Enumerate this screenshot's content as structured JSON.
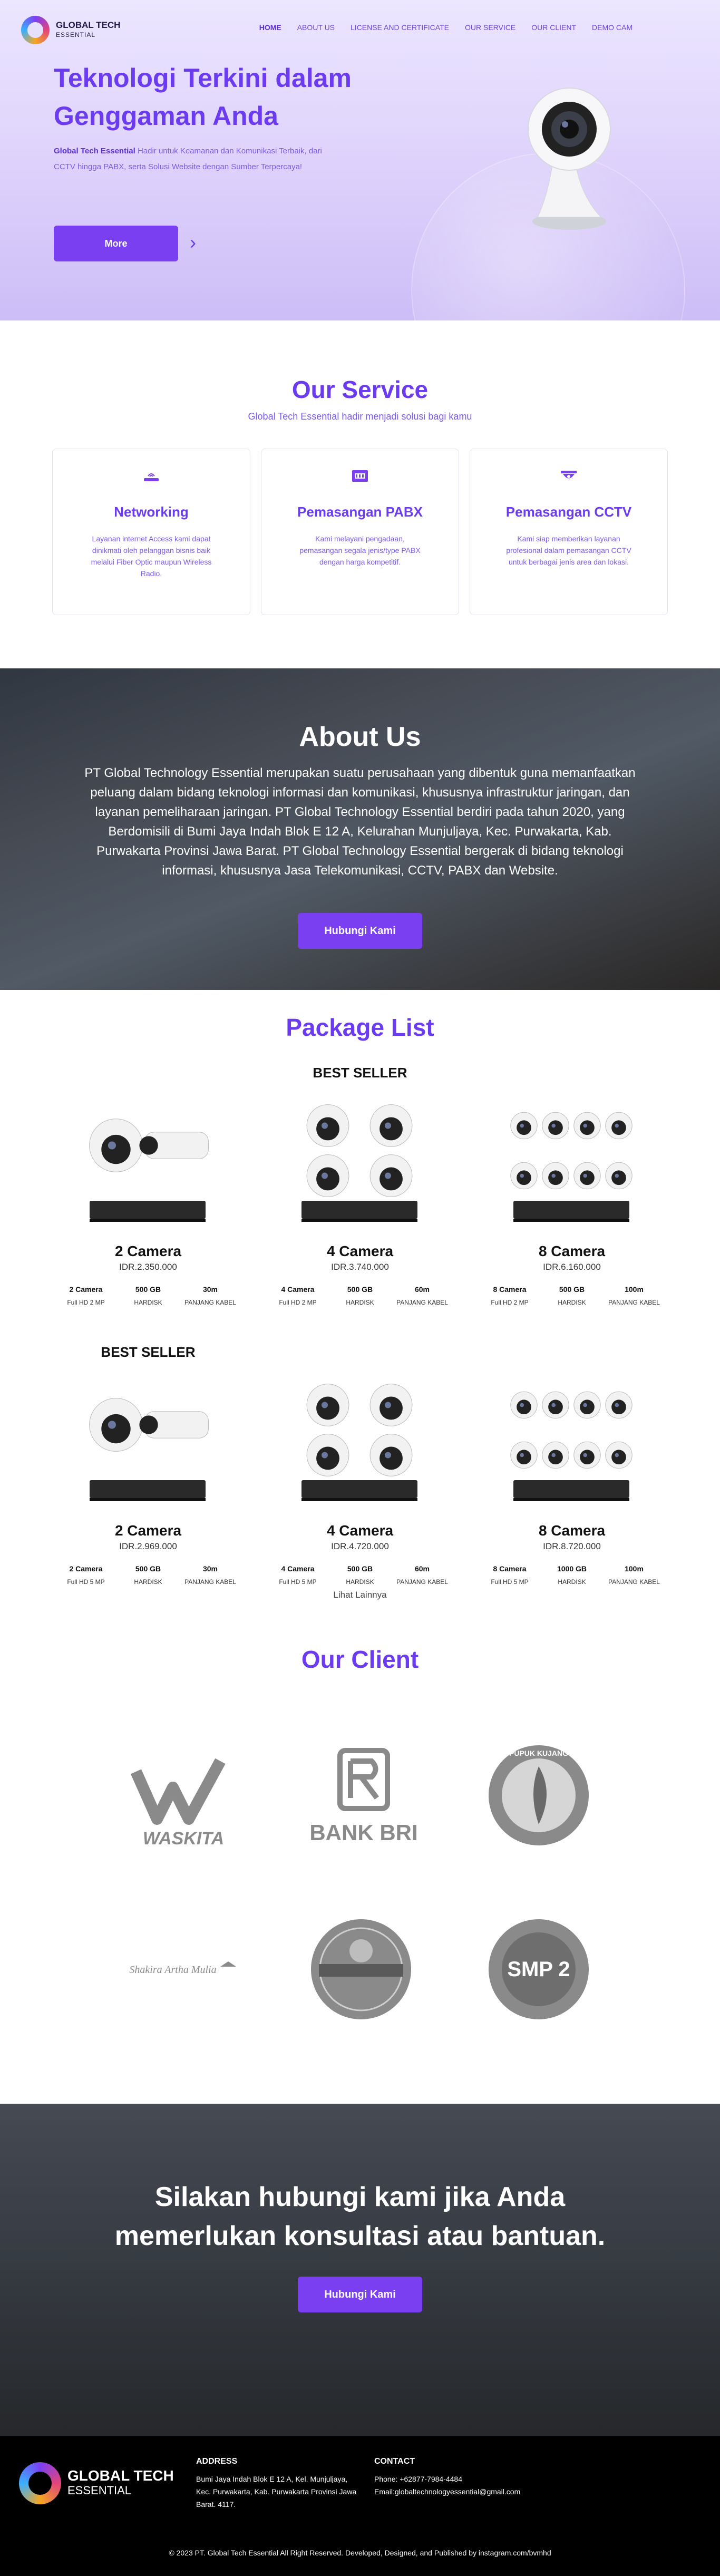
{
  "nav": {
    "brand_top": "GLOBAL TECH",
    "brand_bottom": "ESSENTIAL",
    "items": [
      {
        "label": "HOME"
      },
      {
        "label": "ABOUT US"
      },
      {
        "label": "LICENSE AND CERTIFICATE"
      },
      {
        "label": "OUR SERVICE"
      },
      {
        "label": "OUR CLIENT"
      },
      {
        "label": "DEMO CAM"
      }
    ]
  },
  "hero": {
    "title": "Teknologi Terkini dalam Genggaman Anda",
    "desc_brand": "Global Tech Essential",
    "desc_rest": " Hadir untuk Keamanan dan Komunikasi Terbaik, dari CCTV hingga PABX, serta Solusi Website dengan Sumber Terpercaya!",
    "button": "More",
    "arrow": "›"
  },
  "service": {
    "title": "Our Service",
    "subtitle": "Global Tech Essential hadir menjadi solusi bagi kamu",
    "cards": [
      {
        "title": "Networking",
        "text": "Layanan internet Access kami dapat dinikmati oleh pelanggan bisnis baik melalui Fiber Optic maupun Wireless Radio.",
        "icon": "wifi-icon"
      },
      {
        "title": "Pemasangan PABX",
        "text": "Kami melayani pengadaan, pemasangan segala jenis/type PABX dengan harga kompetitif.",
        "icon": "pabx-icon"
      },
      {
        "title": "Pemasangan CCTV",
        "text": "Kami siap memberikan layanan profesional dalam pemasangan CCTV untuk berbagai jenis area dan lokasi.",
        "icon": "cctv-icon"
      }
    ]
  },
  "about": {
    "title": "About Us",
    "text": "PT Global Technology Essential merupakan suatu perusahaan yang dibentuk guna memanfaatkan peluang dalam bidang teknologi informasi dan komunikasi, khususnya infrastruktur jaringan, dan layanan pemeliharaan jaringan. PT Global Technology Essential berdiri pada tahun 2020, yang Berdomisili di Bumi Jaya Indah Blok E 12 A, Kelurahan Munjuljaya, Kec. Purwakarta, Kab. Purwakarta Provinsi Jawa Barat. PT Global Technology Essential bergerak di bidang teknologi informasi, khususnya Jasa Telekomunikasi, CCTV, PABX dan Website.",
    "button": "Hubungi Kami"
  },
  "package": {
    "title": "Package List",
    "more": "Lihat Lainnya",
    "items": [
      {
        "badge": "",
        "name": "2 Camera",
        "price": "IDR.2.350.000",
        "cams": 2,
        "specs": [
          {
            "top": "2 Camera",
            "bot": "Full HD 2 MP"
          },
          {
            "top": "500 GB",
            "bot": "HARDISK"
          },
          {
            "top": "30m",
            "bot": "PANJANG KABEL"
          }
        ]
      },
      {
        "badge": "BEST SELLER",
        "name": "4 Camera",
        "price": "IDR.3.740.000",
        "cams": 4,
        "specs": [
          {
            "top": "4 Camera",
            "bot": "Full HD 2 MP"
          },
          {
            "top": "500 GB",
            "bot": "HARDISK"
          },
          {
            "top": "60m",
            "bot": "PANJANG KABEL"
          }
        ]
      },
      {
        "badge": "",
        "name": "8 Camera",
        "price": "IDR.6.160.000",
        "cams": 8,
        "specs": [
          {
            "top": "8 Camera",
            "bot": "Full HD 2 MP"
          },
          {
            "top": "500 GB",
            "bot": "HARDISK"
          },
          {
            "top": "100m",
            "bot": "PANJANG KABEL"
          }
        ]
      },
      {
        "badge": "BEST SELLER",
        "name": "2 Camera",
        "price": "IDR.2.969.000",
        "cams": 2,
        "specs": [
          {
            "top": "2 Camera",
            "bot": "Full HD 5 MP"
          },
          {
            "top": "500 GB",
            "bot": "HARDISK"
          },
          {
            "top": "30m",
            "bot": "PANJANG KABEL"
          }
        ]
      },
      {
        "badge": "",
        "name": "4 Camera",
        "price": "IDR.4.720.000",
        "cams": 4,
        "specs": [
          {
            "top": "4 Camera",
            "bot": "Full HD 5 MP"
          },
          {
            "top": "500 GB",
            "bot": "HARDISK"
          },
          {
            "top": "60m",
            "bot": "PANJANG KABEL"
          }
        ]
      },
      {
        "badge": "",
        "name": "8 Camera",
        "price": "IDR.8.720.000",
        "cams": 8,
        "specs": [
          {
            "top": "8 Camera",
            "bot": "Full HD 5 MP"
          },
          {
            "top": "1000 GB",
            "bot": "HARDISK"
          },
          {
            "top": "100m",
            "bot": "PANJANG KABEL"
          }
        ]
      }
    ]
  },
  "client": {
    "title": "Our Client",
    "logos": [
      "WASKITA",
      "BANK BRI",
      "PUPUK KUJANG",
      "Shakira Artha Mulia",
      "",
      "SMP 2"
    ]
  },
  "cta": {
    "title": "Silakan hubungi kami jika Anda memerlukan konsultasi atau bantuan.",
    "button": "Hubungi Kami"
  },
  "footer": {
    "brand_top": "GLOBAL TECH",
    "brand_bottom": "ESSENTIAL",
    "address_title": "ADDRESS",
    "address": "Bumi Jaya Indah Blok E 12 A, Kel. Munjuljaya, Kec. Purwakarta, Kab. Purwakarta Provinsi Jawa Barat. 4117.",
    "contact_title": "CONTACT",
    "phone": "Phone: +62877-7984-4484",
    "email": "Email:globaltechnologyessential@gmail.com",
    "copyright": "© 2023 PT. Global Tech Essential All Right Reserved. Developed, Designed, and Published by instagram.com/bvmhd"
  },
  "colors": {
    "accent": "#7b3ff2",
    "accent_text": "#6b3bf0"
  }
}
